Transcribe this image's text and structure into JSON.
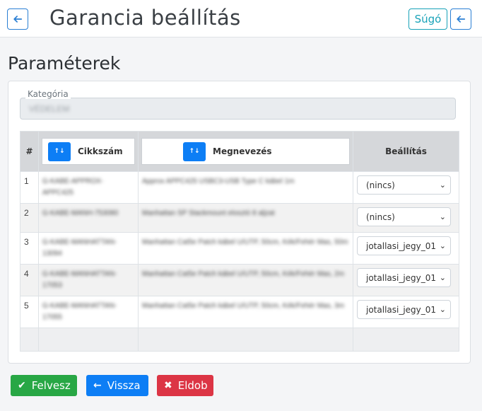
{
  "header": {
    "title": "Garancia beállítás",
    "help_label": "Súgó"
  },
  "section": {
    "title": "Paraméterek"
  },
  "category": {
    "label": "Kategória",
    "value": "VÉDELEM"
  },
  "table": {
    "columns": {
      "num": "#",
      "sku": "Cikkszám",
      "name": "Megnevezés",
      "setting": "Beállítás"
    },
    "sort_icon": "↑↓",
    "rows": [
      {
        "num": "1",
        "sku": "G-KABE-APPROX-APPC425",
        "name": "Approx APPC425 USBC3-USB Type C kábel 1m",
        "setting": "(nincs)"
      },
      {
        "num": "2",
        "sku": "G-KABE-MANH-753080",
        "name": "Manhattan SP Stackmount elosztó 8 aljzat",
        "setting": "(nincs)"
      },
      {
        "num": "3",
        "sku": "G-KABE-MANHATTAN-13094",
        "name": "Manhattan Cat5e Patch kábel U/UTP, 50cm, Kék/Fehér Mas, 50m",
        "setting": "jotallasi_jegy_01"
      },
      {
        "num": "4",
        "sku": "G-KABE-MANHATTAN-17053",
        "name": "Manhattan Cat5e Patch kábel U/UTP, 50cm, Kék/Fehér Mas, 2m",
        "setting": "jotallasi_jegy_01"
      },
      {
        "num": "5",
        "sku": "G-KABE-MANHATTAN-17055",
        "name": "Manhattan Cat5e Patch kábel U/UTP, 50cm, Kék/Fehér Mas, 3m",
        "setting": "jotallasi_jegy_01"
      }
    ]
  },
  "footer": {
    "add_label": "Felvesz",
    "back_label": "Vissza",
    "drop_label": "Eldob"
  },
  "colors": {
    "primary": "#0d7ef5",
    "success": "#28a745",
    "danger": "#dc3545",
    "info": "#17a2b8"
  }
}
